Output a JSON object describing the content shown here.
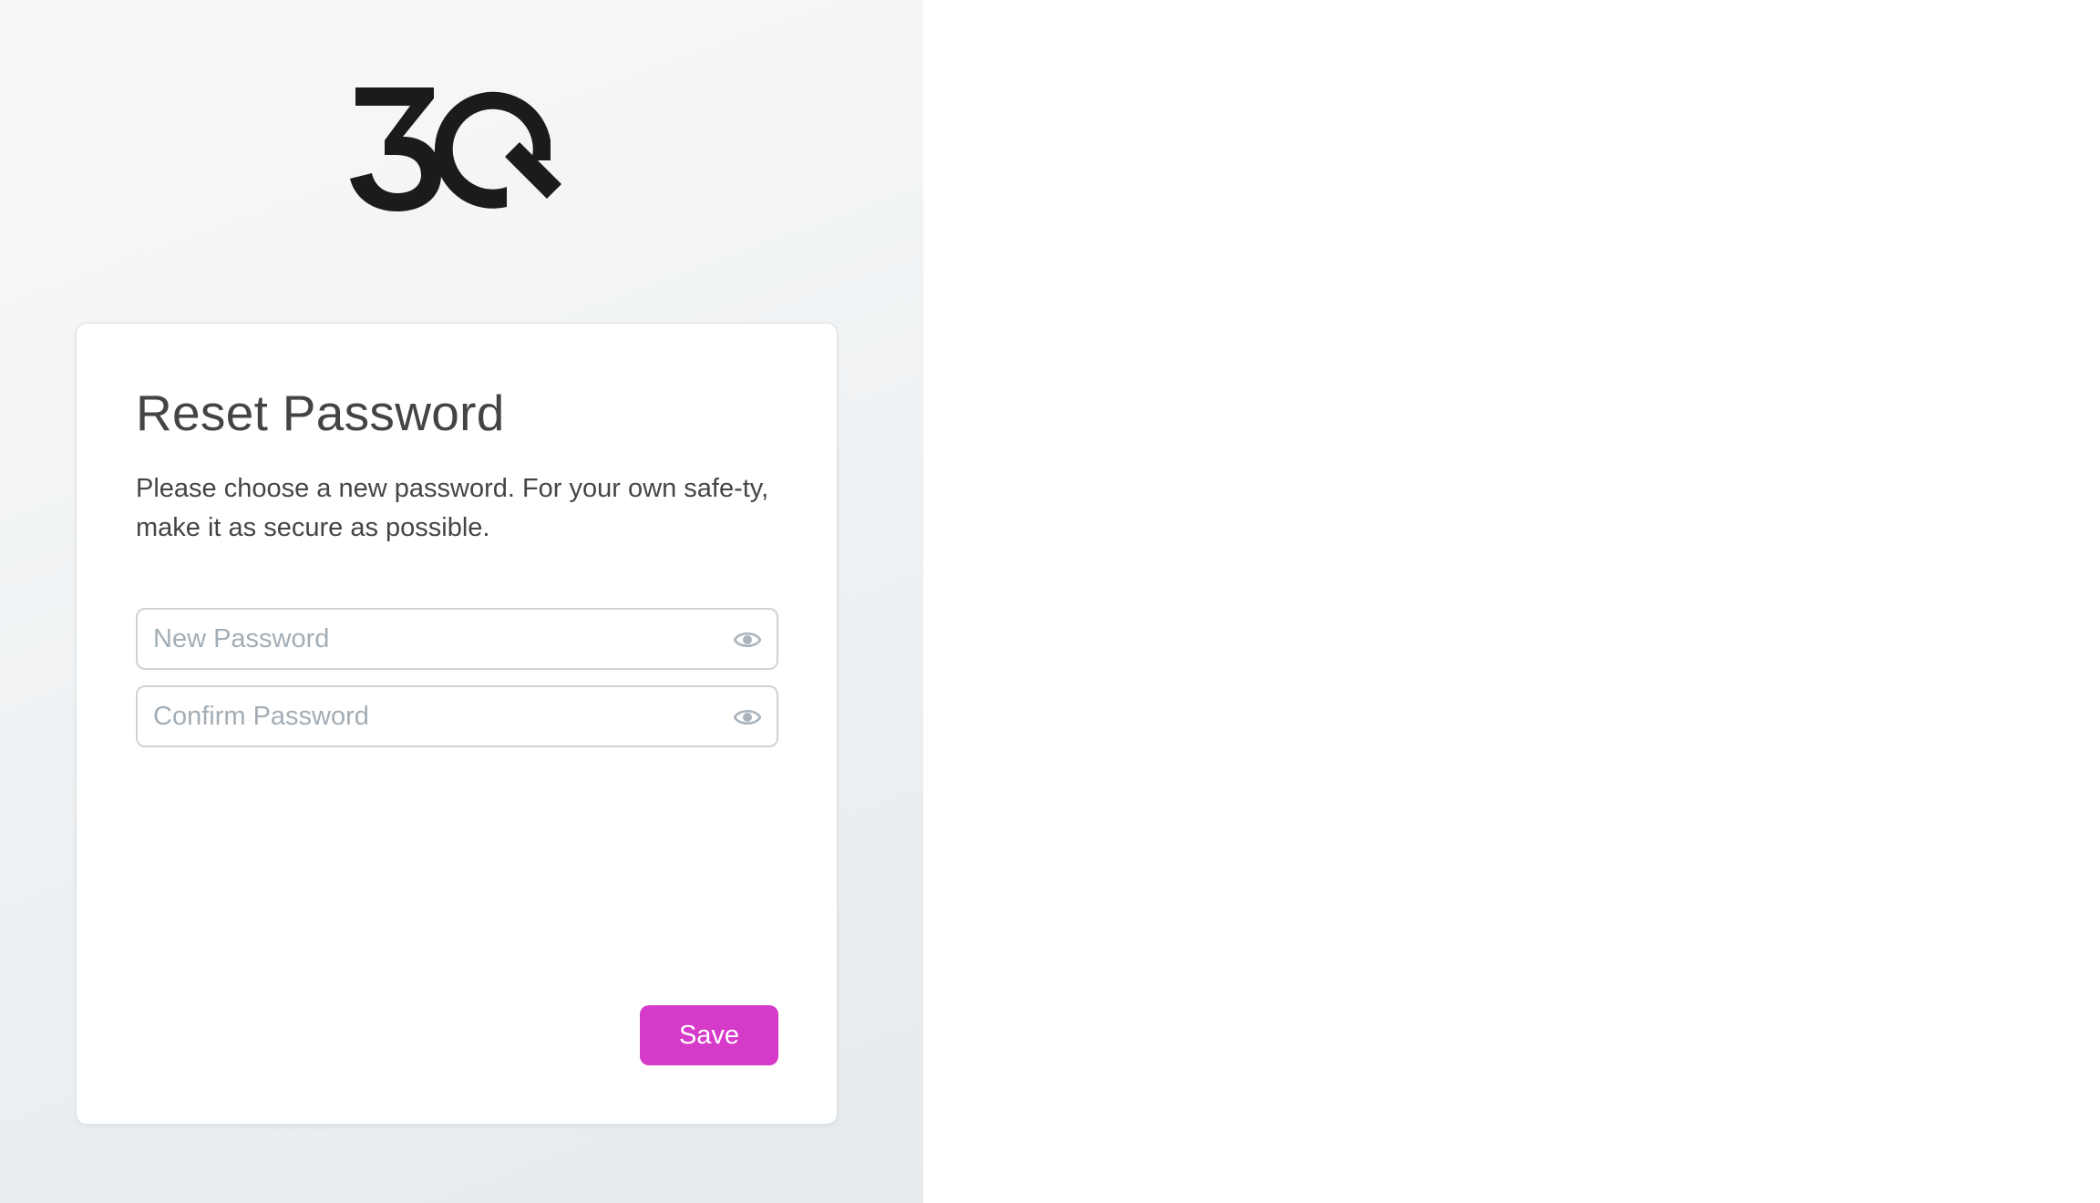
{
  "brand": {
    "logo_text": "3Q",
    "logo_color": "#1b1b1b"
  },
  "reset_card": {
    "title": "Reset Password",
    "description": "Please choose a new password. For your own safe-ty, make it as secure as possible.",
    "new_password": {
      "value": "",
      "placeholder": "New Password",
      "toggle_icon": "eye-icon"
    },
    "confirm_password": {
      "value": "",
      "placeholder": "Confirm Password",
      "toggle_icon": "eye-icon"
    },
    "save_label": "Save"
  },
  "colors": {
    "accent": "#d53bc8",
    "title_text": "#444444",
    "placeholder": "#a3adb5",
    "input_border": "#cdd3d8"
  }
}
